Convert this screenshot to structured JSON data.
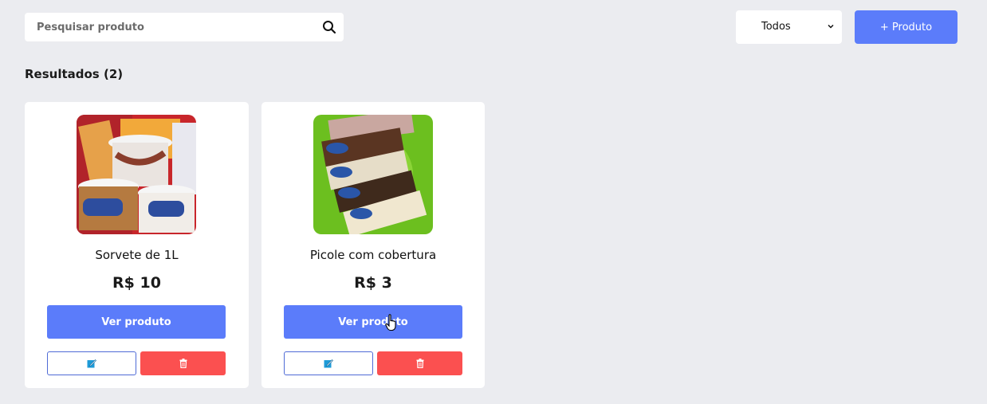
{
  "toolbar": {
    "search_placeholder": "Pesquisar produto",
    "search_value": "",
    "search_icon": "search-icon",
    "filter_value": "Todos",
    "add_label": "+ Produto"
  },
  "results": {
    "title": "Resultados (2)"
  },
  "products": [
    {
      "name": "Sorvete de 1L",
      "price": "R$ 10",
      "view_label": "Ver produto",
      "image": "ice-cream-tubs-photo"
    },
    {
      "name": "Picole com cobertura",
      "price": "R$ 3",
      "view_label": "Ver produto",
      "image": "popsicle-packs-photo"
    }
  ],
  "colors": {
    "primary": "#5b7cfa",
    "danger": "#fb5050",
    "background": "#ebecf0",
    "edit_border": "#4f6bd6"
  }
}
